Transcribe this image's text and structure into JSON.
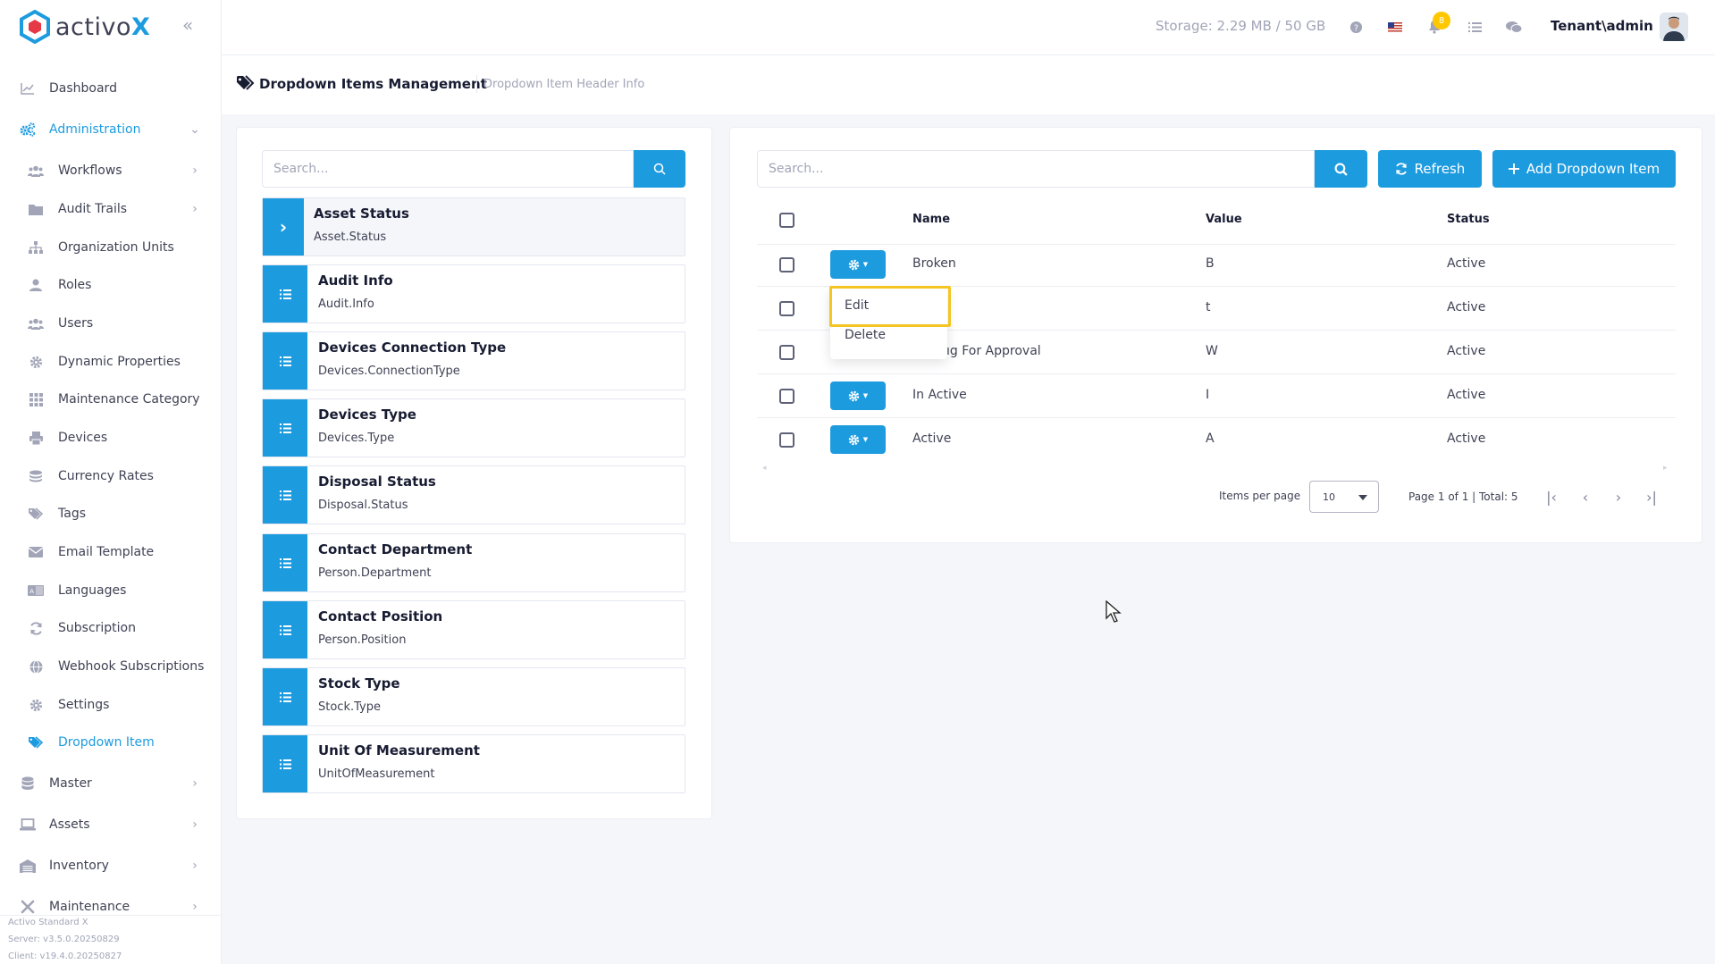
{
  "brand": {
    "name_prefix": "activo",
    "name_suffix": "X",
    "color": "#1d9bdf"
  },
  "sidebar": {
    "items": [
      {
        "label": "Dashboard",
        "icon": "chart-line-icon"
      },
      {
        "label": "Administration",
        "icon": "cogs-icon"
      },
      {
        "label": "Workflows",
        "icon": "users-icon"
      },
      {
        "label": "Audit Trails",
        "icon": "folder-icon"
      },
      {
        "label": "Organization Units",
        "icon": "sitemap-icon"
      },
      {
        "label": "Roles",
        "icon": "user-icon"
      },
      {
        "label": "Users",
        "icon": "users-icon"
      },
      {
        "label": "Dynamic Properties",
        "icon": "gear-icon"
      },
      {
        "label": "Maintenance Category",
        "icon": "grid-icon"
      },
      {
        "label": "Devices",
        "icon": "printer-icon"
      },
      {
        "label": "Currency Rates",
        "icon": "coins-icon"
      },
      {
        "label": "Tags",
        "icon": "tags-icon"
      },
      {
        "label": "Email Template",
        "icon": "envelope-icon"
      },
      {
        "label": "Languages",
        "icon": "language-icon"
      },
      {
        "label": "Subscription",
        "icon": "refresh-icon"
      },
      {
        "label": "Webhook Subscriptions",
        "icon": "globe-icon"
      },
      {
        "label": "Settings",
        "icon": "gear-icon"
      },
      {
        "label": "Dropdown Item",
        "icon": "tags-icon"
      },
      {
        "label": "Master",
        "icon": "database-icon"
      },
      {
        "label": "Assets",
        "icon": "laptop-icon"
      },
      {
        "label": "Inventory",
        "icon": "warehouse-icon"
      },
      {
        "label": "Maintenance",
        "icon": "tools-icon"
      }
    ],
    "footer": {
      "edition": "Activo Standard X",
      "server": "Server: v3.5.0.20250829",
      "client": "Client: v19.4.0.20250827"
    }
  },
  "header": {
    "storage": "Storage: 2.29 MB / 50 GB",
    "notification_count": "8",
    "user": "Tenant\\admin"
  },
  "page": {
    "title": "Dropdown Items Management",
    "subtitle": "Dropdown Item Header Info"
  },
  "left_panel": {
    "search_placeholder": "Search...",
    "items": [
      {
        "title": "Asset Status",
        "code": "Asset.Status"
      },
      {
        "title": "Audit Info",
        "code": "Audit.Info"
      },
      {
        "title": "Devices Connection Type",
        "code": "Devices.ConnectionType"
      },
      {
        "title": "Devices Type",
        "code": "Devices.Type"
      },
      {
        "title": "Disposal Status",
        "code": "Disposal.Status"
      },
      {
        "title": "Contact Department",
        "code": "Person.Department"
      },
      {
        "title": "Contact Position",
        "code": "Person.Position"
      },
      {
        "title": "Stock Type",
        "code": "Stock.Type"
      },
      {
        "title": "Unit Of Measurement",
        "code": "UnitOfMeasurement"
      }
    ]
  },
  "right_panel": {
    "search_placeholder": "Search...",
    "refresh_label": "Refresh",
    "add_label": "Add Dropdown Item",
    "columns": [
      "Name",
      "Value",
      "Status"
    ],
    "rows": [
      {
        "name": "Broken",
        "value": "B",
        "status": "Active"
      },
      {
        "name": "",
        "value": "t",
        "status": "Active"
      },
      {
        "name": "ıg For Approval",
        "value": "W",
        "status": "Active"
      },
      {
        "name": "In Active",
        "value": "I",
        "status": "Active"
      },
      {
        "name": "Active",
        "value": "A",
        "status": "Active"
      }
    ],
    "action_menu": {
      "edit": "Edit",
      "delete": "Delete"
    },
    "pagination": {
      "items_per_page_label": "Items per page",
      "page_size": "10",
      "summary": "Page 1 of 1 | Total: 5"
    }
  }
}
